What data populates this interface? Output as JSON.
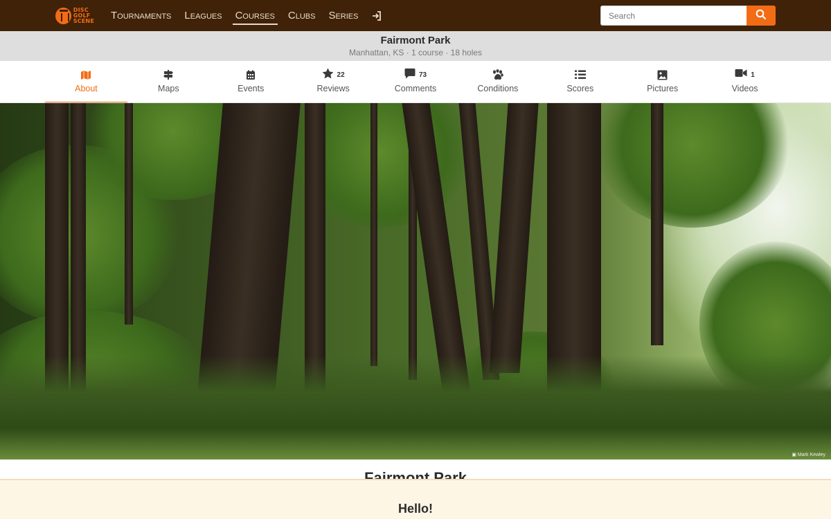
{
  "logo": {
    "line1": "DISC",
    "line2": "GOLF",
    "line3": "SCENE",
    "icon": "disc-golf-basket-icon"
  },
  "nav": {
    "links": [
      "Tournaments",
      "Leagues",
      "Courses",
      "Clubs",
      "Series"
    ],
    "active": "Courses",
    "login_icon": "sign-in-icon"
  },
  "search": {
    "placeholder": "Search",
    "button_icon": "search-icon"
  },
  "course": {
    "name": "Fairmont Park",
    "subtitle": "Manhattan, KS · 1 course · 18 holes"
  },
  "tabs": [
    {
      "label": "About",
      "icon": "map-icon",
      "count": "",
      "active": true
    },
    {
      "label": "Maps",
      "icon": "signpost-icon",
      "count": ""
    },
    {
      "label": "Events",
      "icon": "calendar-icon",
      "count": ""
    },
    {
      "label": "Reviews",
      "icon": "star-icon",
      "count": "22"
    },
    {
      "label": "Comments",
      "icon": "comment-icon",
      "count": "73"
    },
    {
      "label": "Conditions",
      "icon": "paw-icon",
      "count": ""
    },
    {
      "label": "Scores",
      "icon": "list-icon",
      "count": ""
    },
    {
      "label": "Pictures",
      "icon": "image-icon",
      "count": ""
    },
    {
      "label": "Videos",
      "icon": "video-icon",
      "count": "1"
    }
  ],
  "hero": {
    "credit": "Mark Kewley"
  },
  "main": {
    "title": "Fairmont Park"
  },
  "banner": {
    "title": "Hello!"
  },
  "colors": {
    "brand": "#f26c16",
    "topbar": "#3f2207",
    "banner_bg": "#fdf6e4"
  }
}
